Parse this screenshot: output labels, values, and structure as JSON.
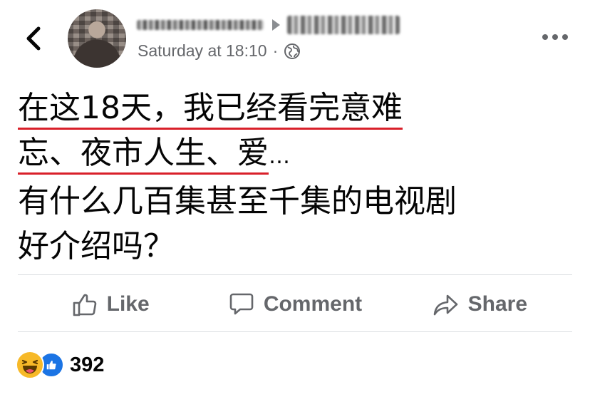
{
  "header": {
    "time": "Saturday at 18:10",
    "separator": "·",
    "audience_icon": "globe-icon"
  },
  "post": {
    "lines": [
      {
        "underlined": "在这18天，我已经看完意难",
        "rest": ""
      },
      {
        "underlined": "忘、夜市人生、爱",
        "rest": "…"
      },
      {
        "underlined": "",
        "rest": "有什么几百集甚至千集的电视剧"
      },
      {
        "underlined": "",
        "rest": "好介绍吗？"
      }
    ]
  },
  "actions": {
    "like": "Like",
    "comment": "Comment",
    "share": "Share"
  },
  "reactions": {
    "icons": [
      "haha-icon",
      "like-icon"
    ],
    "count": "392"
  },
  "colors": {
    "underline": "#d9202a",
    "secondary_text": "#65676b",
    "like_blue": "#1b74e4",
    "haha_yellow": "#f7b928"
  }
}
